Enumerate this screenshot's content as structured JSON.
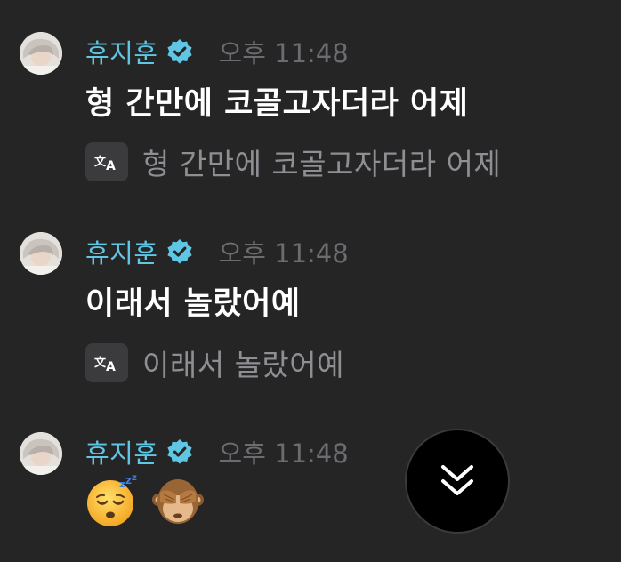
{
  "messages": [
    {
      "author": "휴지훈",
      "time": "오후 11:48",
      "text": "형 간만에 코골고자더라 어제",
      "translation": "형 간만에 코골고자더라 어제"
    },
    {
      "author": "휴지훈",
      "time": "오후 11:48",
      "text": "이래서 놀랐어예",
      "translation": "이래서 놀랐어예"
    },
    {
      "author": "휴지훈",
      "time": "오후 11:48",
      "emojis": [
        "sleeping-face",
        "see-no-evil-monkey"
      ]
    }
  ],
  "icons": {
    "verified": "verified-badge-icon",
    "translate": "translate-icon",
    "scroll": "double-chevron-down-icon"
  },
  "colors": {
    "background": "#252526",
    "author": "#5fc6e4",
    "verified": "#5fc6e4",
    "timestamp": "#6c6c70",
    "translation_text": "#8e8e93",
    "message_text": "#ffffff"
  }
}
